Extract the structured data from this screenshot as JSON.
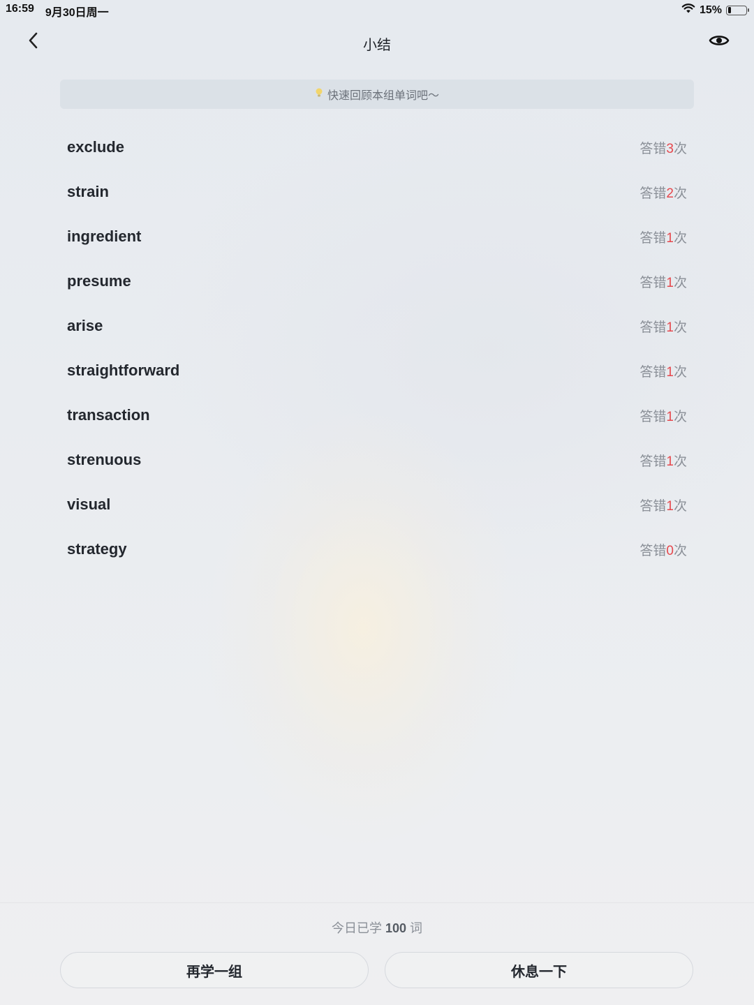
{
  "status_bar": {
    "time": "16:59",
    "date": "9月30日周一",
    "battery_text": "15%",
    "battery_level": 0.15
  },
  "nav": {
    "title": "小结"
  },
  "tip": {
    "text": "快速回顾本组单词吧～"
  },
  "words": [
    {
      "word": "exclude",
      "prefix": "答错",
      "count": "3",
      "suffix": "次"
    },
    {
      "word": "strain",
      "prefix": "答错",
      "count": "2",
      "suffix": "次"
    },
    {
      "word": "ingredient",
      "prefix": "答错",
      "count": "1",
      "suffix": "次"
    },
    {
      "word": "presume",
      "prefix": "答错",
      "count": "1",
      "suffix": "次"
    },
    {
      "word": "arise",
      "prefix": "答错",
      "count": "1",
      "suffix": "次"
    },
    {
      "word": "straightforward",
      "prefix": "答错",
      "count": "1",
      "suffix": "次"
    },
    {
      "word": "transaction",
      "prefix": "答错",
      "count": "1",
      "suffix": "次"
    },
    {
      "word": "strenuous",
      "prefix": "答错",
      "count": "1",
      "suffix": "次"
    },
    {
      "word": "visual",
      "prefix": "答错",
      "count": "1",
      "suffix": "次"
    },
    {
      "word": "strategy",
      "prefix": "答错",
      "count": "0",
      "suffix": "次"
    }
  ],
  "footer": {
    "learned_prefix": "今日已学",
    "learned_count": "100",
    "learned_suffix": "词",
    "left_button": "再学一组",
    "right_button": "休息一下"
  },
  "icons": {
    "back": "chevron-left-icon",
    "eye": "eye-icon",
    "tip": "lightbulb-icon",
    "wifi": "wifi-icon",
    "battery": "battery-icon"
  },
  "colors": {
    "wrong_count": "#e5484d",
    "muted_text": "#8a8f97",
    "primary_text": "#23272e"
  }
}
